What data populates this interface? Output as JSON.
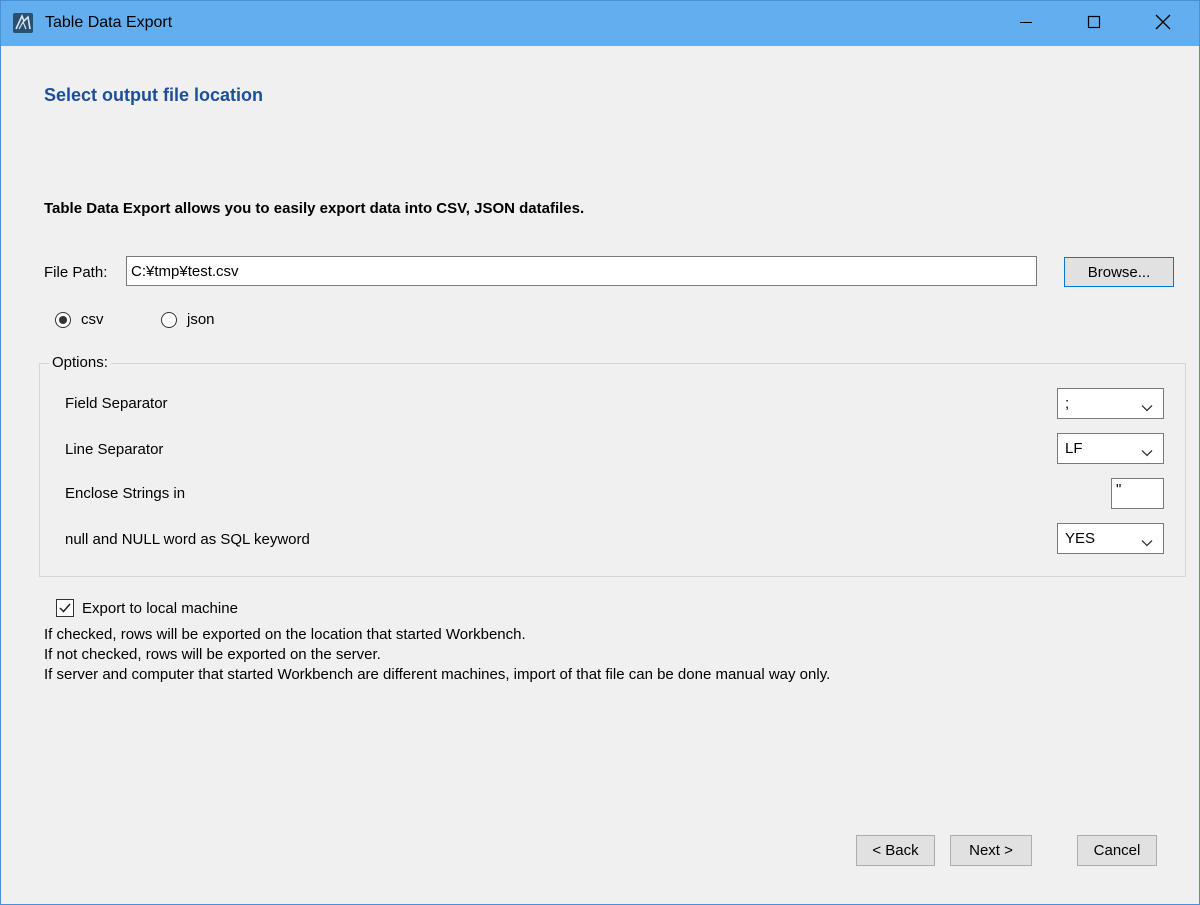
{
  "window": {
    "title": "Table Data Export",
    "controls": {
      "minimize": "minimize",
      "maximize": "maximize",
      "close": "close"
    }
  },
  "page": {
    "heading": "Select output file location",
    "intro": "Table Data Export allows you to easily export data into CSV, JSON datafiles."
  },
  "file_path": {
    "label": "File Path:",
    "value": "C:¥tmp¥test.csv",
    "browse_label": "Browse..."
  },
  "format": {
    "options": [
      {
        "label": "csv",
        "selected": true
      },
      {
        "label": "json",
        "selected": false
      }
    ]
  },
  "options": {
    "legend": "Options:",
    "field_separator": {
      "label": "Field Separator",
      "value": ";"
    },
    "line_separator": {
      "label": "Line Separator",
      "value": "LF"
    },
    "enclose_strings": {
      "label": "Enclose Strings in",
      "value": "\""
    },
    "null_keyword": {
      "label": "null and NULL word as SQL keyword",
      "value": "YES"
    }
  },
  "export_local": {
    "label": "Export to local machine",
    "checked": true,
    "notes": [
      "If checked, rows will be exported on the location that started Workbench.",
      "If not checked, rows will be exported on the server.",
      "If server and computer that started Workbench are different machines, import of that file can be done manual way only."
    ]
  },
  "footer": {
    "back_label": "< Back",
    "next_label": "Next >",
    "cancel_label": "Cancel"
  },
  "colors": {
    "titlebar": "#63aeee",
    "heading": "#1c4e9c",
    "focus_border": "#0078d7"
  },
  "icons": {
    "app": "mysql-workbench-icon",
    "minimize": "minimize-icon",
    "maximize": "maximize-icon",
    "close": "close-icon",
    "dropdown": "chevron-down-icon",
    "check": "checkmark-icon"
  }
}
